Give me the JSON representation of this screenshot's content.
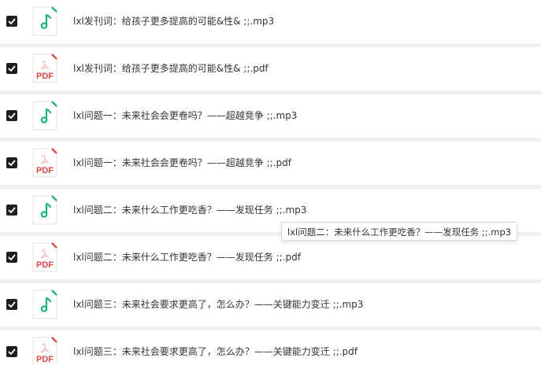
{
  "colors": {
    "audio_icon": "#1db176",
    "pdf_icon": "#e04848",
    "checkbox": "#1f1f1f",
    "row_bg": "#ffffff",
    "separator": "#f0f0f2"
  },
  "files": [
    {
      "name": "lxl发刊词：给孩子更多提高的可能&性&  ;;.mp3",
      "type": "audio",
      "icon": "music-file-icon",
      "checked": true
    },
    {
      "name": "lxl发刊词：给孩子更多提高的可能&性&  ;;.pdf",
      "type": "pdf",
      "icon_label": "PDF",
      "icon": "pdf-file-icon",
      "checked": true
    },
    {
      "name": "lxl问题一：未来社会会更卷吗？——超越竞争  ;;.mp3",
      "type": "audio",
      "icon": "music-file-icon",
      "checked": true
    },
    {
      "name": "lxl问题一：未来社会会更卷吗？——超越竞争  ;;.pdf",
      "type": "pdf",
      "icon_label": "PDF",
      "icon": "pdf-file-icon",
      "checked": true
    },
    {
      "name": "lxl问题二：未来什么工作更吃香？——发现任务  ;;.mp3",
      "type": "audio",
      "icon": "music-file-icon",
      "checked": true
    },
    {
      "name": "lxl问题二：未来什么工作更吃香？——发现任务  ;;.pdf",
      "type": "pdf",
      "icon_label": "PDF",
      "icon": "pdf-file-icon",
      "checked": true
    },
    {
      "name": "lxl问题三：未来社会要求更高了，怎么办？——关键能力变迁  ;;.mp3",
      "type": "audio",
      "icon": "music-file-icon",
      "checked": true
    },
    {
      "name": "lxl问题三：未来社会要求更高了，怎么办？——关键能力变迁  ;;.pdf",
      "type": "pdf",
      "icon_label": "PDF",
      "icon": "pdf-file-icon",
      "checked": true
    }
  ],
  "tooltip": {
    "text": "lxl问题二：未来什么工作更吃香？——发现任务  ;;.mp3"
  }
}
